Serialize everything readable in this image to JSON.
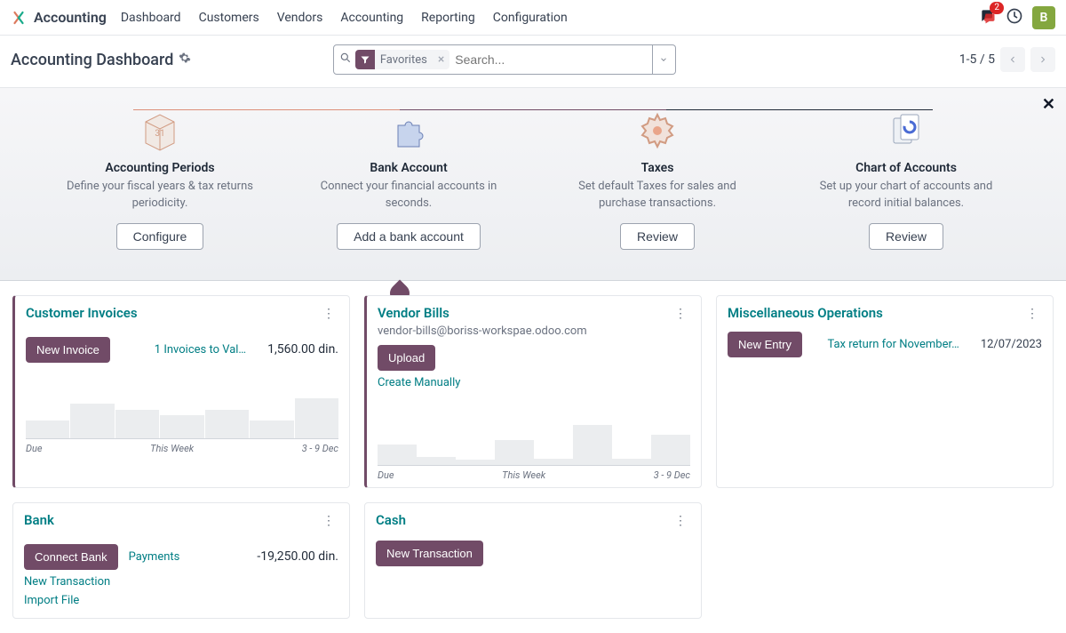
{
  "app": {
    "title": "Accounting"
  },
  "nav": {
    "items": [
      {
        "label": "Dashboard"
      },
      {
        "label": "Customers"
      },
      {
        "label": "Vendors"
      },
      {
        "label": "Accounting"
      },
      {
        "label": "Reporting"
      },
      {
        "label": "Configuration"
      }
    ],
    "notification_count": "2",
    "avatar_initial": "B"
  },
  "control": {
    "page_title": "Accounting Dashboard",
    "search_placeholder": "Search...",
    "facet_label": "Favorites",
    "pager": "1-5 / 5"
  },
  "onboarding": {
    "steps": [
      {
        "title": "Accounting Periods",
        "desc": "Define your fiscal years & tax returns periodicity.",
        "button": "Configure"
      },
      {
        "title": "Bank Account",
        "desc": "Connect your financial accounts in seconds.",
        "button": "Add a bank account"
      },
      {
        "title": "Taxes",
        "desc": "Set default Taxes for sales and purchase transactions.",
        "button": "Review"
      },
      {
        "title": "Chart of Accounts",
        "desc": "Set up your chart of accounts and record initial balances.",
        "button": "Review"
      }
    ]
  },
  "cards": {
    "invoices": {
      "title": "Customer Invoices",
      "primary_btn": "New Invoice",
      "link": "1 Invoices to Val…",
      "amount": "1,560.00 din."
    },
    "bills": {
      "title": "Vendor Bills",
      "subtitle": "vendor-bills@boriss-workspae.odoo.com",
      "primary_btn": "Upload",
      "create_link": "Create Manually"
    },
    "misc": {
      "title": "Miscellaneous Operations",
      "primary_btn": "New Entry",
      "link": "Tax return for November…",
      "date": "12/07/2023"
    },
    "bank": {
      "title": "Bank",
      "primary_btn": "Connect Bank",
      "payments_link": "Payments",
      "amount": "-19,250.00 din.",
      "link_new": "New Transaction",
      "link_import": "Import File"
    },
    "cash": {
      "title": "Cash",
      "primary_btn": "New Transaction"
    }
  },
  "chart_data": [
    {
      "type": "bar",
      "title": "Customer Invoices aging",
      "categories": [
        "Due",
        "This Week",
        "3 - 9 Dec"
      ],
      "values_relative": [
        15,
        30,
        25,
        20,
        25,
        15,
        35
      ],
      "xlabel": "",
      "ylabel": "",
      "ylim": [
        0,
        40
      ]
    },
    {
      "type": "bar",
      "title": "Vendor Bills aging",
      "categories": [
        "Due",
        "This Week",
        "3 - 9 Dec"
      ],
      "values_relative": [
        20,
        8,
        5,
        25,
        6,
        40,
        6,
        30
      ],
      "xlabel": "",
      "ylabel": "",
      "ylim": [
        0,
        45
      ]
    }
  ],
  "chart_labels": {
    "due": "Due",
    "this_week": "This Week",
    "dec": "3 - 9 Dec"
  }
}
